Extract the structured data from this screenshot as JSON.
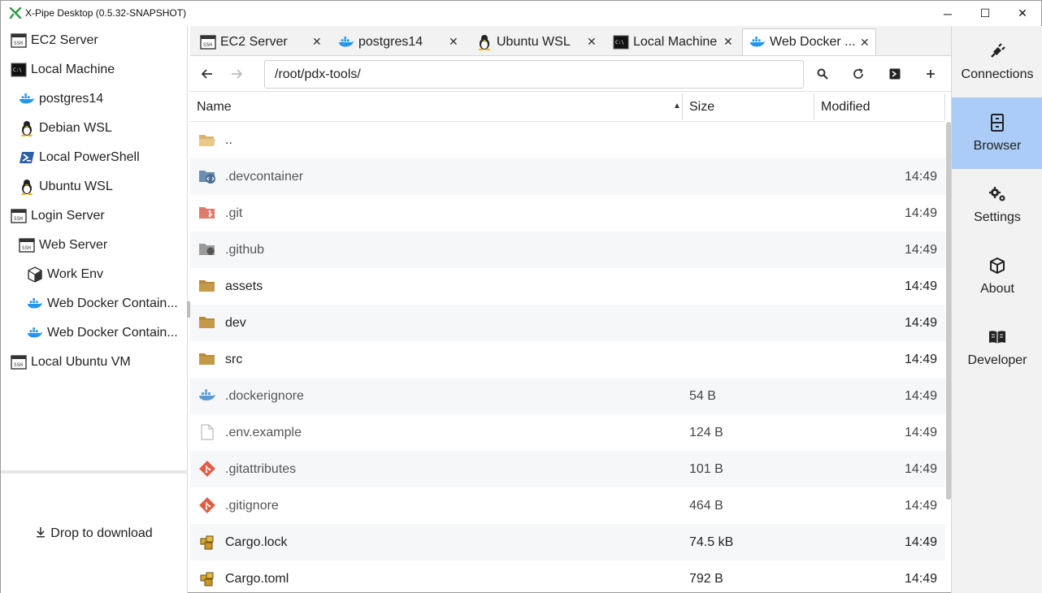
{
  "window": {
    "title": "X-Pipe Desktop (0.5.32-SNAPSHOT)",
    "controls": {
      "minimize": "─",
      "maximize": "☐",
      "close": "✕"
    }
  },
  "sidebar": {
    "items": [
      {
        "label": "EC2 Server",
        "icon": "ssh-terminal-icon"
      },
      {
        "label": "Local Machine",
        "icon": "cmd-terminal-icon"
      },
      {
        "label": "postgres14",
        "icon": "docker-icon"
      },
      {
        "label": "Debian WSL",
        "icon": "linux-penguin-icon"
      },
      {
        "label": "Local PowerShell",
        "icon": "powershell-icon"
      },
      {
        "label": "Ubuntu WSL",
        "icon": "linux-penguin-icon"
      },
      {
        "label": "Login Server",
        "icon": "ssh-terminal-icon"
      },
      {
        "label": "Web Server",
        "icon": "ssh-terminal-icon"
      },
      {
        "label": "Work Env",
        "icon": "cube-icon"
      },
      {
        "label": "Web Docker Contain...",
        "icon": "docker-icon"
      },
      {
        "label": "Web Docker Contain...",
        "icon": "docker-icon"
      },
      {
        "label": "Local Ubuntu VM",
        "icon": "ssh-terminal-icon"
      }
    ],
    "drop_label": "Drop to download"
  },
  "tabs": [
    {
      "label": "EC2 Server",
      "icon": "ssh-terminal-icon"
    },
    {
      "label": "postgres14",
      "icon": "docker-icon"
    },
    {
      "label": "Ubuntu WSL",
      "icon": "linux-penguin-icon"
    },
    {
      "label": "Local Machine",
      "icon": "cmd-terminal-icon"
    },
    {
      "label": "Web Docker ...",
      "icon": "docker-icon",
      "active": true
    }
  ],
  "toolbar": {
    "path": "/root/pdx-tools/"
  },
  "table": {
    "columns": {
      "name": "Name",
      "size": "Size",
      "modified": "Modified"
    },
    "rows": [
      {
        "name": "..",
        "size": "",
        "modified": "",
        "icon": "open-folder-icon"
      },
      {
        "name": ".devcontainer",
        "size": "",
        "modified": "14:49",
        "icon": "devcontainer-folder-icon"
      },
      {
        "name": ".git",
        "size": "",
        "modified": "14:49",
        "icon": "git-folder-icon"
      },
      {
        "name": ".github",
        "size": "",
        "modified": "14:49",
        "icon": "github-folder-icon"
      },
      {
        "name": "assets",
        "size": "",
        "modified": "14:49",
        "icon": "folder-icon"
      },
      {
        "name": "dev",
        "size": "",
        "modified": "14:49",
        "icon": "folder-icon"
      },
      {
        "name": "src",
        "size": "",
        "modified": "14:49",
        "icon": "folder-icon"
      },
      {
        "name": ".dockerignore",
        "size": "54 B",
        "modified": "14:49",
        "icon": "docker-file-icon"
      },
      {
        "name": ".env.example",
        "size": "124 B",
        "modified": "14:49",
        "icon": "file-icon"
      },
      {
        "name": ".gitattributes",
        "size": "101 B",
        "modified": "14:49",
        "icon": "git-file-icon"
      },
      {
        "name": ".gitignore",
        "size": "464 B",
        "modified": "14:49",
        "icon": "git-file-icon"
      },
      {
        "name": "Cargo.lock",
        "size": "74.5 kB",
        "modified": "14:49",
        "icon": "cargo-icon"
      },
      {
        "name": "Cargo.toml",
        "size": "792 B",
        "modified": "14:49",
        "icon": "cargo-icon"
      }
    ]
  },
  "rightnav": {
    "items": [
      {
        "label": "Connections",
        "icon": "plug-icon"
      },
      {
        "label": "Browser",
        "icon": "file-cabinet-icon",
        "active": true
      },
      {
        "label": "Settings",
        "icon": "gears-icon"
      },
      {
        "label": "About",
        "icon": "box-icon"
      },
      {
        "label": "Developer",
        "icon": "book-icon"
      }
    ]
  },
  "colors": {
    "accent": "#aaccf6",
    "folder": "#c49a4a",
    "git": "#e05d44",
    "docker": "#2496ed"
  }
}
